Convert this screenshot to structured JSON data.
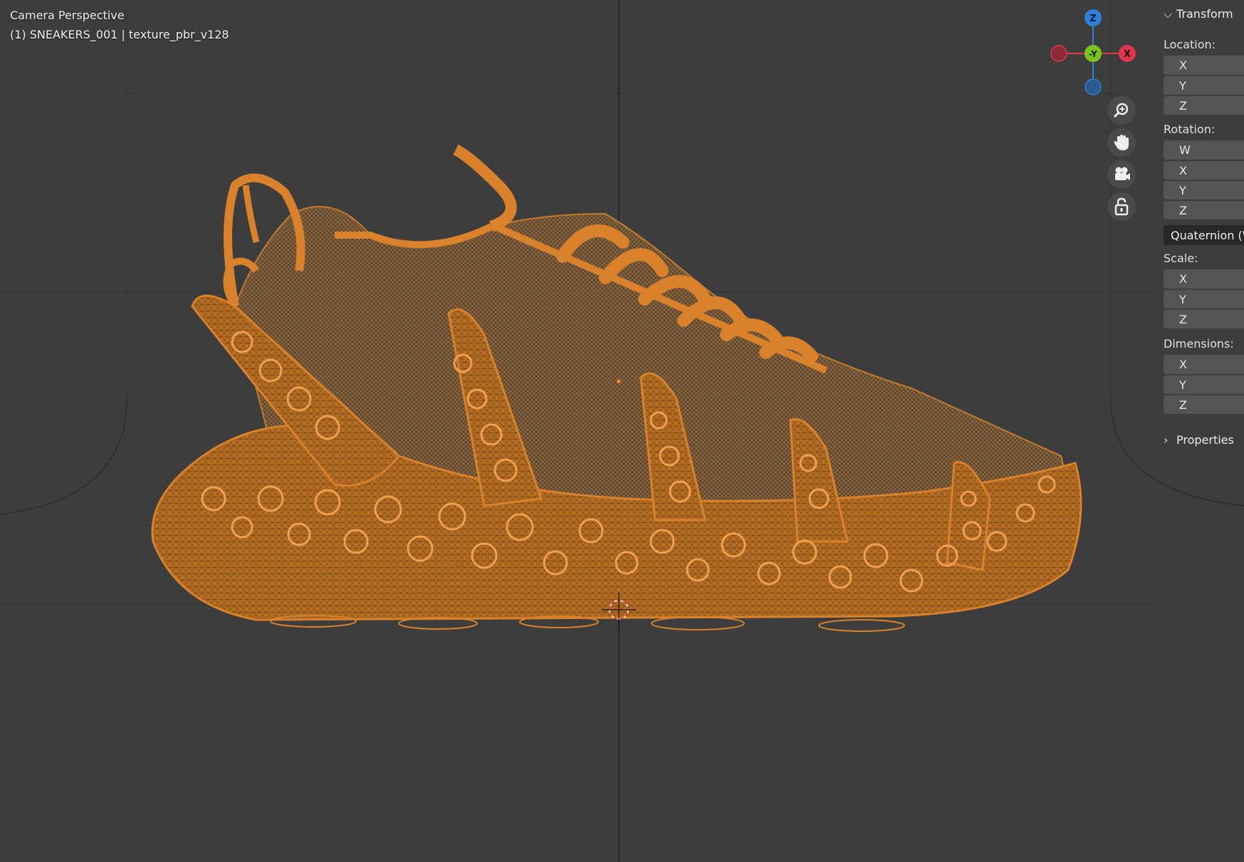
{
  "viewport": {
    "title": "Camera Perspective",
    "object_info": "(1) SNEAKERS_001 | texture_pbr_v128",
    "mesh_color": "#d9822b",
    "background": "#3d3d3d"
  },
  "gizmo": {
    "z_label": "Z",
    "y_label": "-Y",
    "x_label": "X",
    "x_color": "#e0384b",
    "y_color": "#7bc21f",
    "z_color": "#2f7fd6"
  },
  "nav_tools": {
    "zoom": "zoom-icon",
    "pan": "hand-icon",
    "camera": "camera-icon",
    "lock": "lock-icon"
  },
  "panel": {
    "transform_header": "Transform",
    "location": {
      "label": "Location:",
      "axes": [
        "X",
        "Y",
        "Z"
      ]
    },
    "rotation": {
      "label": "Rotation:",
      "axes": [
        "W",
        "X",
        "Y",
        "Z"
      ],
      "mode": "Quaternion (W"
    },
    "scale": {
      "label": "Scale:",
      "axes": [
        "X",
        "Y",
        "Z"
      ]
    },
    "dimensions": {
      "label": "Dimensions:",
      "axes": [
        "X",
        "Y",
        "Z"
      ]
    },
    "properties_header": "Properties"
  }
}
